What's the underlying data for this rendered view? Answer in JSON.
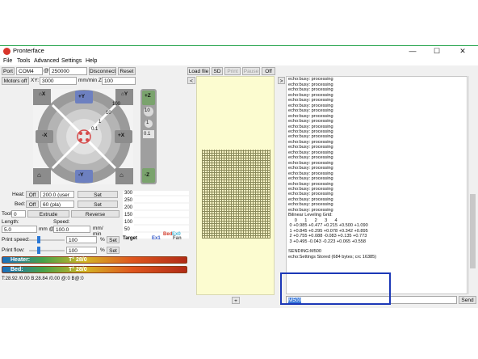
{
  "window": {
    "title": "Pronterface",
    "controls": [
      "—",
      "☐",
      "✕"
    ]
  },
  "menu": [
    "File",
    "Tools",
    "Advanced",
    "Settings",
    "Help"
  ],
  "toolbar": {
    "port_label": "Port",
    "port_value": "COM4",
    "at_label": "@",
    "baud_value": "250000",
    "disconnect": "Disconnect",
    "reset": "Reset",
    "motors_off": "Motors off",
    "xy_label": "XY:",
    "xy_value": "3000",
    "z_label": "mm/min Z:",
    "z_value": "100",
    "load_file": "Load file",
    "sd": "SD",
    "print": "Print",
    "pause": "Pause",
    "off": "Off"
  },
  "jog": {
    "y_plus": "+Y",
    "y_minus": "-Y",
    "x_plus": "+X",
    "x_minus": "-X",
    "z_plus": "+Z",
    "z_minus": "-Z",
    "home_xy": "⌂",
    "home_z": "⌂",
    "home_x": "⌂X",
    "home_y": "⌂Y",
    "ring_labels": [
      "100",
      "10",
      "1",
      "0.1"
    ],
    "z_labels": [
      "10",
      "1",
      "0.1"
    ]
  },
  "temps": {
    "heat_label": "Heat:",
    "heat_off": "Off",
    "heat_value": "200.0 (user",
    "heat_set": "Set",
    "bed_label": "Bed:",
    "bed_off": "Off",
    "bed_value": "60 (pla)",
    "bed_set": "Set",
    "tool_label": "Tool:",
    "tool_value": "0",
    "extrude": "Extrude",
    "reverse": "Reverse",
    "length_label": "Length:",
    "length_value": "5.0",
    "length_unit": "mm @",
    "speed_label": "Speed:",
    "speed_value": "100.0",
    "speed_unit": "mm/ min",
    "print_speed_label": "Print speed:",
    "print_speed_value": "100",
    "print_speed_unit": "%",
    "print_speed_set": "Set",
    "print_flow_label": "Print flow:",
    "print_flow_value": "100",
    "print_flow_unit": "%",
    "print_flow_set": "Set",
    "heater_label": "Heater:",
    "heater_value": "T° 28/0",
    "bed_bar_label": "Bed:",
    "bed_bar_value": "T° 28/0",
    "status": "T:28.92 /0.00 B:28.84 /0.00 @:0 B@:0"
  },
  "graph": {
    "yticks": [
      "300",
      "250",
      "200",
      "150",
      "100",
      "50"
    ],
    "legend": [
      "Target",
      "Ex1",
      "Bed",
      "Ex0",
      "Fan"
    ],
    "legend_colors": [
      "#000000",
      "#2f55c8",
      "#d23b2b",
      "#3fb5d6",
      "#555555"
    ]
  },
  "console": {
    "collapse": "<",
    "expand": ">",
    "lines": [
      "echo:busy: processing",
      "echo:busy: processing",
      "echo:busy: processing",
      "echo:busy: processing",
      "echo:busy: processing",
      "echo:busy: processing",
      "echo:busy: processing",
      "echo:busy: processing",
      "echo:busy: processing",
      "echo:busy: processing",
      "echo:busy: processing",
      "echo:busy: processing",
      "echo:busy: processing",
      "echo:busy: processing",
      "echo:busy: processing",
      "echo:busy: processing",
      "echo:busy: processing",
      "echo:busy: processing",
      "echo:busy: processing",
      "echo:busy: processing",
      "echo:busy: processing",
      "echo:busy: processing",
      "echo:busy: processing",
      "echo:busy: processing",
      "echo:busy: processing",
      "echo:busy: processing",
      "echo:busy: processing",
      "Bilinear Leveling Grid:",
      "     0      1      2      3      4",
      " 0 +0.985 +0.477 +0.215 +0.500 +1.090",
      " 1 +0.845 +0.295 +0.078 +0.342 +0.895",
      " 2 +0.755 +0.088 -0.083 +0.135 +0.773",
      " 3 +0.495 -0.043 -0.223 +0.065 +0.558",
      "",
      "SENDING:M500",
      "echo:Settings Stored (684 bytes; crc 16385)"
    ],
    "input_value": "M500",
    "send": "Send"
  },
  "bottom_scroll": "+"
}
